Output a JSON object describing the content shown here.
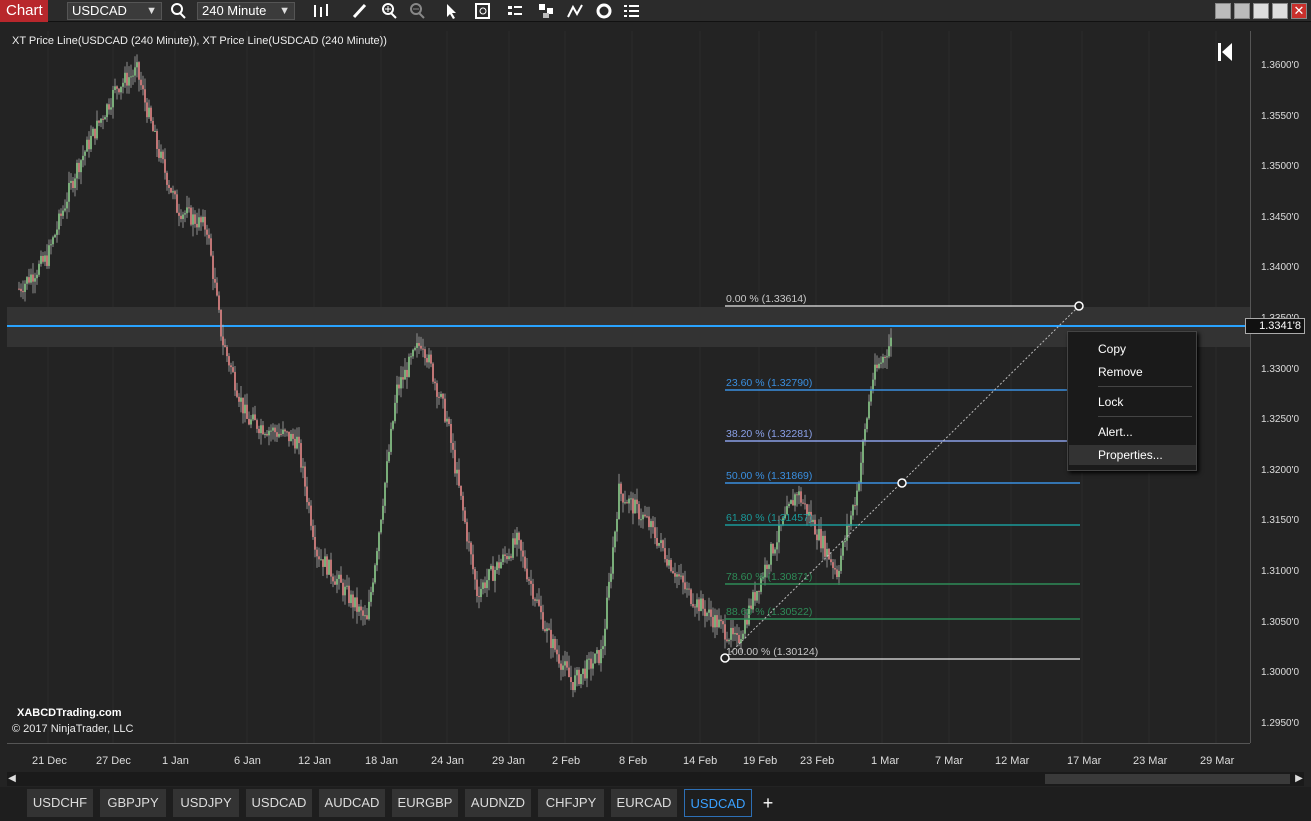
{
  "window": {
    "tab_label": "Chart"
  },
  "toolbar": {
    "instrument": "USDCAD",
    "interval": "240 Minute",
    "icons": [
      "search-icon",
      "bar-style-icon",
      "draw-icon",
      "zoom-in-icon",
      "zoom-out-icon",
      "pointer-icon",
      "data-box-icon",
      "indicators-icon",
      "strategies-icon",
      "drawing-tools-icon",
      "refresh-icon",
      "properties-icon"
    ],
    "window_buttons": [
      "minimize",
      "maximize",
      "restore",
      "close"
    ]
  },
  "chart": {
    "title": "XT Price Line(USDCAD (240 Minute)), XT Price Line(USDCAD (240 Minute))",
    "watermark_1": "XABCDTrading.com",
    "watermark_2": "© 2017 NinjaTrader, LLC",
    "current_price": "1.3341'8",
    "price_labels": [
      "1.3600'0",
      "1.3550'0",
      "1.3500'0",
      "1.3450'0",
      "1.3400'0",
      "1.3350'0",
      "1.3300'0",
      "1.3250'0",
      "1.3200'0",
      "1.3150'0",
      "1.3100'0",
      "1.3050'0",
      "1.3000'0",
      "1.2950'0"
    ],
    "time_labels": [
      "21 Dec",
      "27 Dec",
      "1 Jan",
      "6 Jan",
      "12 Jan",
      "18 Jan",
      "24 Jan",
      "29 Jan",
      "2 Feb",
      "8 Feb",
      "14 Feb",
      "19 Feb",
      "23 Feb",
      "1 Mar",
      "7 Mar",
      "12 Mar",
      "17 Mar",
      "23 Mar",
      "29 Mar"
    ],
    "fib_levels": [
      {
        "label": "0.00 % (1.33614)",
        "color": "#c8c8c8"
      },
      {
        "label": "23.60 % (1.32790)",
        "color": "#3a8fe0"
      },
      {
        "label": "38.20 % (1.32281)",
        "color": "#8aa0e8"
      },
      {
        "label": "50.00 % (1.31869)",
        "color": "#3a8fe0"
      },
      {
        "label": "61.80 % (1.31457)",
        "color": "#1a9a9a"
      },
      {
        "label": "78.60 % (1.30871)",
        "color": "#2e8b57"
      },
      {
        "label": "88.60 % (1.30522)",
        "color": "#2e8b57"
      },
      {
        "label": "100.00 % (1.30124)",
        "color": "#c8c8c8"
      }
    ]
  },
  "context_menu": {
    "items": [
      "Copy",
      "Remove",
      "Lock",
      "Alert...",
      "Properties..."
    ],
    "selected": "Properties..."
  },
  "tabs": {
    "items": [
      "USDCHF",
      "GBPJPY",
      "USDJPY",
      "USDCAD",
      "AUDCAD",
      "EURGBP",
      "AUDNZD",
      "CHFJPY",
      "EURCAD",
      "USDCAD"
    ],
    "active_index": 9,
    "add_label": "+"
  }
}
